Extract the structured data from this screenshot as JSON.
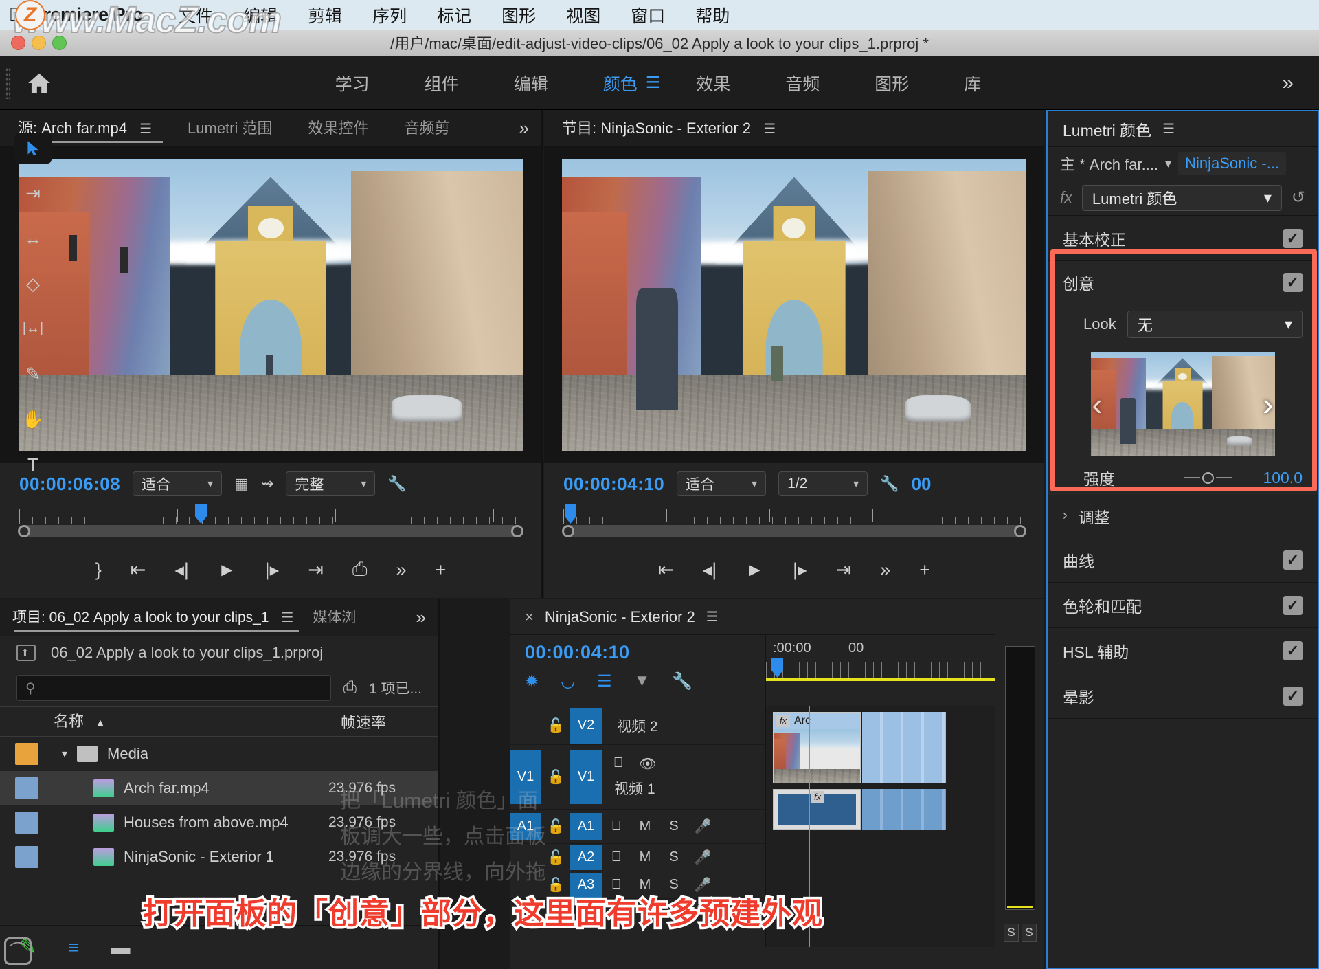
{
  "app": {
    "name": "Premiere Pro",
    "apple_menu_icon": "apple-icon",
    "watermark": "www.MacZ.com",
    "watermark_badge": "Z",
    "menus": [
      "文件",
      "编辑",
      "剪辑",
      "序列",
      "标记",
      "图形",
      "视图",
      "窗口",
      "帮助"
    ]
  },
  "titlebar": {
    "path": "/用户/mac/桌面/edit-adjust-video-clips/06_02 Apply a look to your clips_1.prproj *"
  },
  "workspace": {
    "home_icon": "home-icon",
    "tabs": [
      {
        "label": "学习",
        "active": false
      },
      {
        "label": "组件",
        "active": false
      },
      {
        "label": "编辑",
        "active": false
      },
      {
        "label": "颜色",
        "active": true
      },
      {
        "label": "效果",
        "active": false
      },
      {
        "label": "音频",
        "active": false
      },
      {
        "label": "图形",
        "active": false
      },
      {
        "label": "库",
        "active": false
      }
    ],
    "more_label": "»"
  },
  "source_monitor": {
    "tabs": [
      {
        "label": "源: Arch far.mp4",
        "active": true
      },
      {
        "label": "Lumetri 范围",
        "active": false
      },
      {
        "label": "效果控件",
        "active": false
      },
      {
        "label": "音频剪",
        "active": false
      }
    ],
    "more_label": "»",
    "timecode": "00:00:06:08",
    "fit_value": "适合",
    "quality_value": "完整",
    "icons": [
      "film-icon",
      "audio-waveform-icon",
      "wrench-icon"
    ],
    "transport": [
      "mark-out-icon",
      "go-to-in-icon",
      "step-back-icon",
      "play-icon",
      "step-forward-icon",
      "go-to-out-icon",
      "insert-icon",
      "more-icon",
      "add-icon"
    ]
  },
  "program_monitor": {
    "tab_label": "节目: NinjaSonic - Exterior 2",
    "timecode": "00:00:04:10",
    "fit_value": "适合",
    "resolution_value": "1/2",
    "trailing_timecode": "00",
    "transport": [
      "go-to-in-icon",
      "step-back-icon",
      "play-icon",
      "step-forward-icon",
      "go-to-out-icon",
      "more-icon",
      "add-icon"
    ]
  },
  "lumetri": {
    "panel_title": "Lumetri 颜色",
    "hamburger_icon": "hamburger-icon",
    "master_clip": "主 * Arch far....",
    "sequence_name": "NinjaSonic -...",
    "fx_icon": "fx-icon",
    "effect_name": "Lumetri 颜色",
    "reset_icon": "reset-icon",
    "sections": [
      {
        "label": "基本校正",
        "checked": true,
        "expanded": false
      },
      {
        "label": "创意",
        "checked": true,
        "expanded": true,
        "highlighted": true
      },
      {
        "label": "调整",
        "checked": false,
        "expanded": false,
        "carat": "›"
      },
      {
        "label": "曲线",
        "checked": true,
        "expanded": false
      },
      {
        "label": "色轮和匹配",
        "checked": true,
        "expanded": false
      },
      {
        "label": "HSL 辅助",
        "checked": true,
        "expanded": false
      },
      {
        "label": "晕影",
        "checked": true,
        "expanded": false
      }
    ],
    "creative": {
      "title": "创意",
      "look_label": "Look",
      "look_value": "无",
      "prev_arrow": "‹",
      "next_arrow": "›",
      "intensity_label": "强度",
      "intensity_value": "100.0"
    },
    "accent_color": "#3a9cf5",
    "highlight_color": "#fb6a56"
  },
  "project": {
    "tabs": [
      {
        "label": "项目: 06_02 Apply a look to your clips_1",
        "active": true
      },
      {
        "label": "媒体浏",
        "active": false
      }
    ],
    "more_label": "»",
    "breadcrumb": "06_02 Apply a look to your clips_1.prproj",
    "search_placeholder": "",
    "search_value": "",
    "search_icon": "search-icon",
    "filter_icon": "filter-bin-icon",
    "item_count": "1 项已...",
    "columns": [
      "名称",
      "帧速率"
    ],
    "sort_indicator": "▲",
    "rows": [
      {
        "type": "bin",
        "swatch": "#e8a33d",
        "name": "Media",
        "fps": "",
        "expanded": true,
        "selected": false
      },
      {
        "type": "clip",
        "swatch": "#7aa2cc",
        "name": "Arch far.mp4",
        "fps": "23.976 fps",
        "selected": true
      },
      {
        "type": "clip",
        "swatch": "#7aa2cc",
        "name": "Houses from above.mp4",
        "fps": "23.976 fps",
        "selected": false
      },
      {
        "type": "clip",
        "swatch": "#7aa2cc",
        "name": "NinjaSonic - Exterior 1",
        "fps": "23.976 fps",
        "selected": false
      }
    ],
    "footer_icons": [
      "pencil-icon",
      "list-view-icon",
      "icon-view-icon"
    ]
  },
  "tools": [
    {
      "name": "selection-tool",
      "glyph": "➤",
      "active": true
    },
    {
      "name": "track-select-forward-tool",
      "glyph": "⇥",
      "active": false
    },
    {
      "name": "ripple-edit-tool",
      "glyph": "↔",
      "active": false
    },
    {
      "name": "razor-tool",
      "glyph": "✂",
      "active": false
    },
    {
      "name": "slip-tool",
      "glyph": "|↔|",
      "active": false
    },
    {
      "name": "pen-tool",
      "glyph": "✒",
      "active": false
    },
    {
      "name": "hand-tool",
      "glyph": "✋",
      "active": false
    },
    {
      "name": "type-tool",
      "glyph": "T",
      "active": false
    }
  ],
  "timeline": {
    "close_icon": "close-icon",
    "tab_label": "NinjaSonic - Exterior 2",
    "hamburger_icon": "hamburger-icon",
    "timecode": "00:00:04:10",
    "tool_icons": [
      "snap-linked-icon",
      "magnet-icon",
      "marker-insert-icon",
      "marker-icon",
      "wrench-icon"
    ],
    "ruler_labels": [
      ":00:00",
      "00"
    ],
    "tracks": [
      {
        "id": "V2",
        "name": "视频 2",
        "type": "video",
        "targeted": false,
        "locked": false
      },
      {
        "id": "V1",
        "name": "视频 1",
        "type": "video",
        "targeted": true,
        "locked": false,
        "sync": "sync-icon",
        "eye": "eye-icon"
      },
      {
        "id": "A1",
        "name": "",
        "type": "audio",
        "targeted": true,
        "m": "M",
        "s": "S",
        "mic": "mic-icon"
      },
      {
        "id": "A2",
        "name": "",
        "type": "audio",
        "targeted": false,
        "m": "M",
        "s": "S",
        "mic": "mic-icon"
      },
      {
        "id": "A3",
        "name": "",
        "type": "audio",
        "targeted": false,
        "m": "M",
        "s": "S",
        "mic": "mic-icon"
      }
    ],
    "clip_label": "Arc",
    "clip_fx_badge": "fx"
  },
  "meters": {
    "solo_labels": [
      "S",
      "S"
    ]
  },
  "captions": {
    "bottom": "打开面板的「创意」部分，这里面有许多预建外观",
    "bottom2": "这里面有许多预建外观",
    "ghost_lines": [
      "把「Lumetri 颜色」面",
      "板调大一些，点击面板",
      "边缘的分界线，向外拖"
    ]
  },
  "cc_logo": "creative-cloud-icon"
}
